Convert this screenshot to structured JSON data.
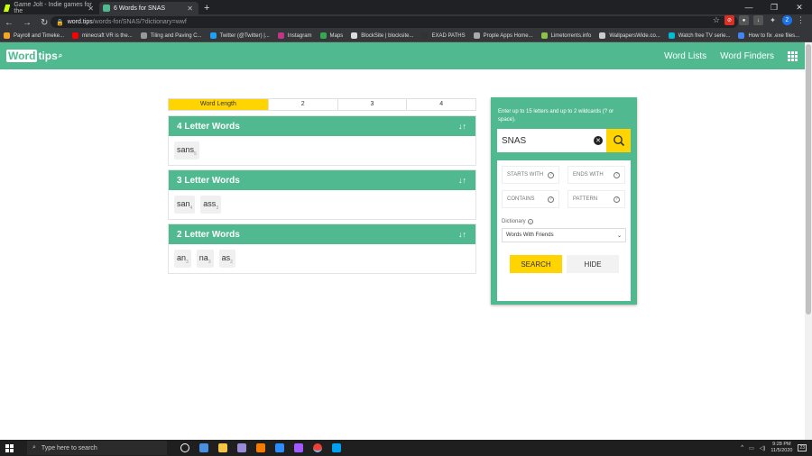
{
  "browser": {
    "tabs": [
      {
        "title": "Game Jolt - Indie games for the"
      },
      {
        "title": "6 Words for SNAS"
      }
    ],
    "url_host": "word.tips",
    "url_path": "/words-for/SNAS/?dictionary=wwf",
    "bookmarks": [
      "Payroll and Timeke...",
      "minecraft VR is the...",
      "Tiling and Paving C...",
      "Twitter (@Twitter) |...",
      "Instagram",
      "Maps",
      "BlockSite | blocksite...",
      "EXAD PATHS",
      "Prople Apps Home...",
      "Limetorrents.info",
      "WallpapersWide.co...",
      "Watch free TV serie...",
      "How to fix .exe files..."
    ],
    "bookmark_colors": [
      "#f6a623",
      "#ff0000",
      "#999999",
      "#1da1f2",
      "#c13584",
      "#34a853",
      "#dddddd",
      "#333333",
      "#aaaaaa",
      "#8bc34a",
      "#cccccc",
      "#00bcd4",
      "#4285f4"
    ]
  },
  "site": {
    "logo_box": "Word",
    "logo_rest": "tips",
    "nav": {
      "word_lists": "Word Lists",
      "word_finders": "Word Finders"
    }
  },
  "length_filter": {
    "label": "Word Length",
    "options": [
      "2",
      "3",
      "4"
    ]
  },
  "groups": [
    {
      "title": "4 Letter Words",
      "words": [
        {
          "w": "sans",
          "s": "5"
        }
      ]
    },
    {
      "title": "3 Letter Words",
      "words": [
        {
          "w": "san",
          "s": "4"
        },
        {
          "w": "ass",
          "s": "3"
        }
      ]
    },
    {
      "title": "2 Letter Words",
      "words": [
        {
          "w": "an",
          "s": "3"
        },
        {
          "w": "na",
          "s": "3"
        },
        {
          "w": "as",
          "s": "2"
        }
      ]
    }
  ],
  "panel": {
    "instructions": "Enter up to 15 letters and up to 2 wildcards (? or space).",
    "search_value": "SNAS",
    "filters": {
      "starts_with": "STARTS WITH",
      "ends_with": "ENDS WITH",
      "contains": "CONTAINS",
      "pattern": "PATTERN"
    },
    "dictionary_label": "Dictionary",
    "dictionary_value": "Words With Friends",
    "search_button": "SEARCH",
    "hide_button": "HIDE"
  },
  "taskbar": {
    "search_placeholder": "Type here to search",
    "time": "9:28 PM",
    "date": "11/5/2020",
    "notif_count": "23",
    "app_colors": [
      "#ffffff",
      "#4a90e2",
      "#f6c344",
      "#9b8bd6",
      "#f57c00",
      "#2d8cff",
      "#a259ff",
      "#ea4335",
      "#00a1f1"
    ]
  },
  "colors": {
    "brand_green": "#50b990",
    "accent_yellow": "#ffd400"
  }
}
